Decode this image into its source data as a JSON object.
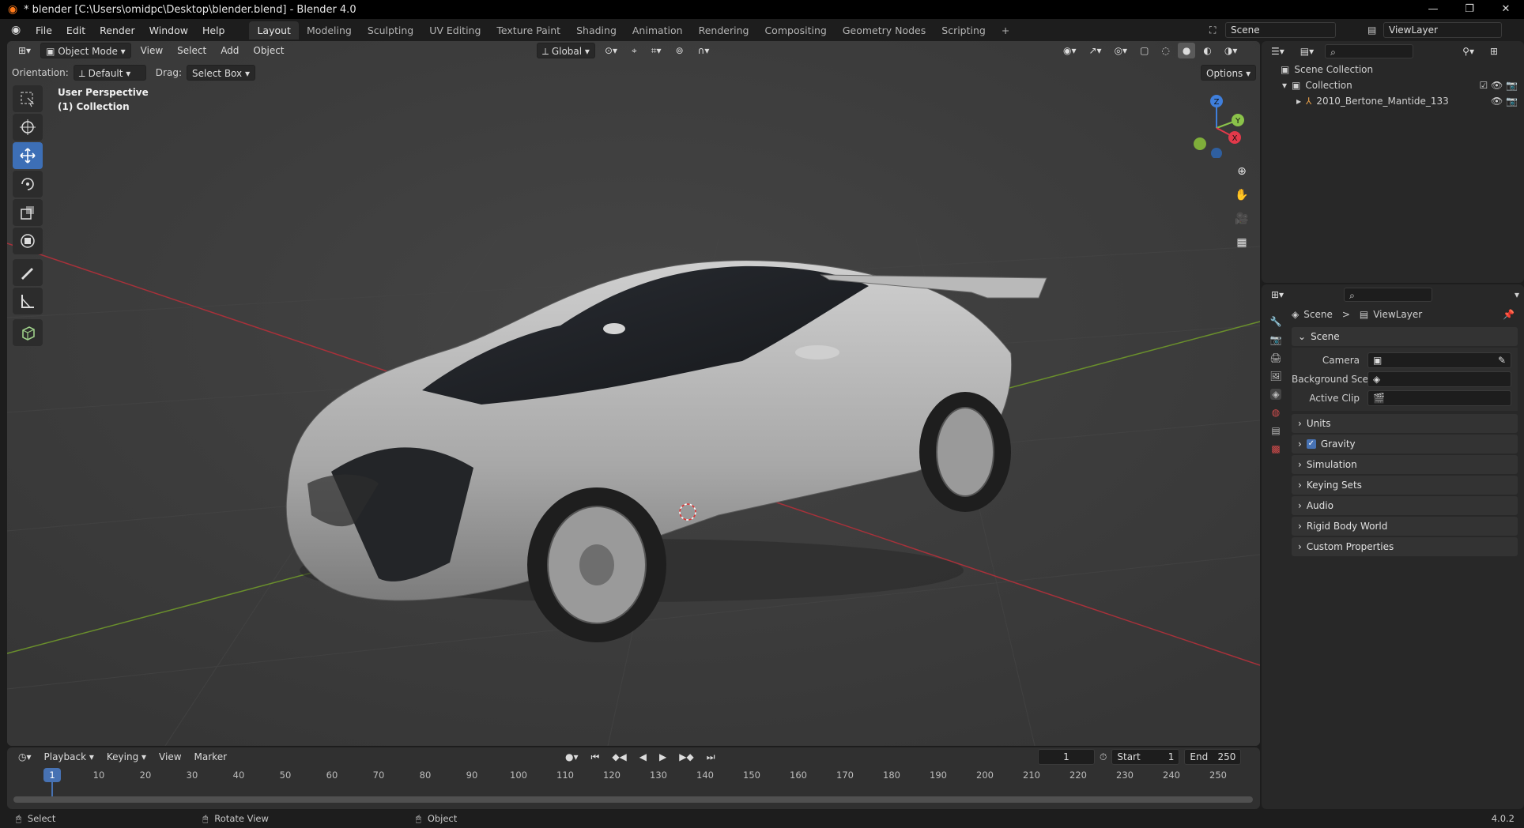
{
  "titlebar": {
    "title": "* blender [C:\\Users\\omidpc\\Desktop\\blender.blend] - Blender 4.0",
    "minimize": "—",
    "restore": "❐",
    "close": "✕"
  },
  "menus": [
    "File",
    "Edit",
    "Render",
    "Window",
    "Help"
  ],
  "workspaces": [
    "Layout",
    "Modeling",
    "Sculpting",
    "UV Editing",
    "Texture Paint",
    "Shading",
    "Animation",
    "Rendering",
    "Compositing",
    "Geometry Nodes",
    "Scripting"
  ],
  "workspace_add": "+",
  "scene_selector": {
    "label": "Scene"
  },
  "viewlayer_selector": {
    "label": "ViewLayer"
  },
  "viewport": {
    "mode": "Object Mode",
    "menus": [
      "View",
      "Select",
      "Add",
      "Object"
    ],
    "transform_orientation": "Global",
    "orientation_label": "Orientation:",
    "orientation_value": "Default",
    "drag_label": "Drag:",
    "drag_value": "Select Box",
    "options": "Options",
    "overlay_line1": "User Perspective",
    "overlay_line2": "(1) Collection",
    "gizmo": {
      "z": "Z",
      "y": "Y",
      "x": "X"
    }
  },
  "outliner": {
    "scene_collection": "Scene Collection",
    "collection": "Collection",
    "object": "2010_Bertone_Mantide_133"
  },
  "properties": {
    "breadcrumb_scene": "Scene",
    "breadcrumb_sep": ">",
    "breadcrumb_viewlayer": "ViewLayer",
    "section_scene": "Scene",
    "camera_label": "Camera",
    "background_scene_label": "Background Scene",
    "active_clip_label": "Active Clip",
    "sections": [
      "Units",
      "Gravity",
      "Simulation",
      "Keying Sets",
      "Audio",
      "Rigid Body World",
      "Custom Properties"
    ],
    "gravity_checked": true
  },
  "timeline": {
    "menus": [
      "Playback",
      "Keying",
      "View",
      "Marker"
    ],
    "current_frame": "1",
    "start_label": "Start",
    "start_value": "1",
    "end_label": "End",
    "end_value": "250",
    "ticks": [
      "1",
      "10",
      "20",
      "30",
      "40",
      "50",
      "60",
      "70",
      "80",
      "90",
      "100",
      "110",
      "120",
      "130",
      "140",
      "150",
      "160",
      "170",
      "180",
      "190",
      "200",
      "210",
      "220",
      "230",
      "240",
      "250"
    ]
  },
  "statusbar": {
    "select": "Select",
    "rotate_view": "Rotate View",
    "object": "Object",
    "version": "4.0.2"
  },
  "colors": {
    "accent_blue": "#3d6fb6",
    "axis_red": "#c8343f",
    "axis_green": "#6b9a2a",
    "gizmo_x": "#e2394a",
    "gizmo_y": "#8bc34a",
    "gizmo_z": "#3f7fdc"
  }
}
